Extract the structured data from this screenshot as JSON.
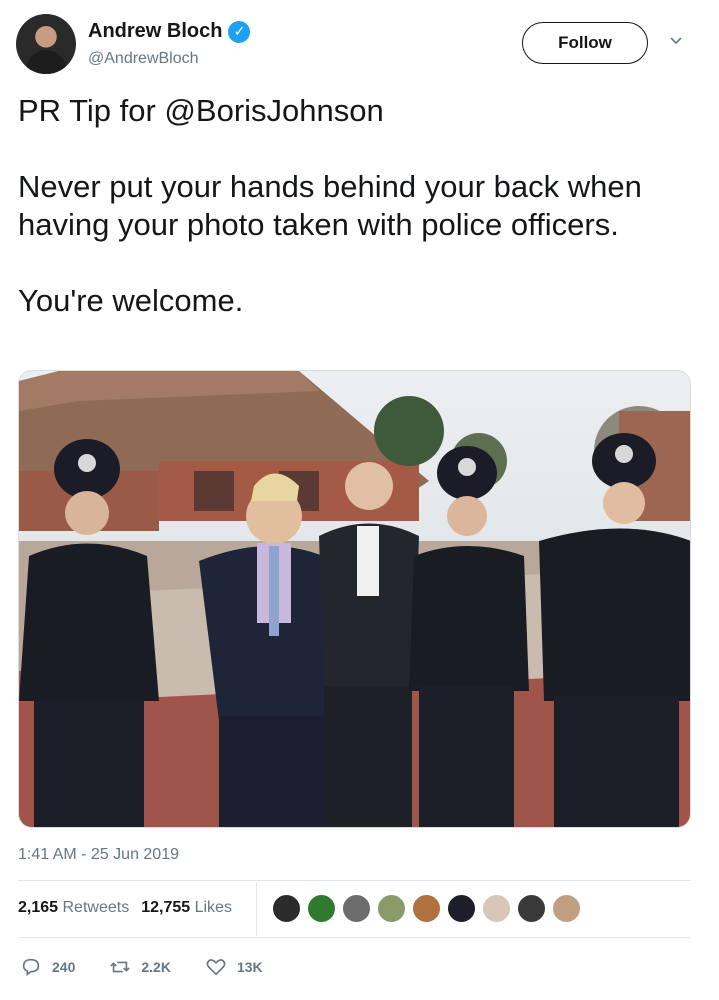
{
  "tweet": {
    "author": {
      "display_name": "Andrew Bloch",
      "handle": "@AndrewBloch",
      "verified": true,
      "avatar_icon": "profile-photo"
    },
    "follow_label": "Follow",
    "more_icon": "chevron-down-icon",
    "paragraphs": [
      "PR Tip for @BorisJohnson",
      "Never put your hands behind your back when having your photo taken with police officers.",
      "You're welcome."
    ],
    "photo_icon": "photo-police-officers",
    "timestamp": "1:41 AM - 25 Jun 2019",
    "stats": {
      "retweets_count": "2,165",
      "retweets_label": "Retweets",
      "likes_count": "12,755",
      "likes_label": "Likes"
    },
    "likers": [
      "#2b2b2b",
      "#2f7a2e",
      "#6c6c6c",
      "#8a9b6a",
      "#b07040",
      "#1e1e2a",
      "#d8c6b8",
      "#3a3a3a",
      "#c0a080"
    ],
    "actions": {
      "reply_count": "240",
      "retweet_count": "2.2K",
      "like_count": "13K"
    }
  },
  "colors": {
    "accent": "#1da1f2",
    "text": "#14171a",
    "secondary": "#657786"
  }
}
